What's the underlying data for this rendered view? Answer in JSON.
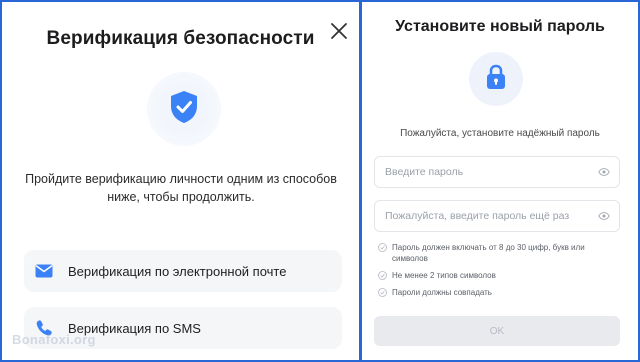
{
  "left": {
    "title": "Верификация безопасности",
    "description": "Пройдите верификацию личности одним из способов ниже, чтобы продолжить.",
    "options": [
      {
        "label": "Верификация по электронной почте",
        "icon": "envelope-icon"
      },
      {
        "label": "Верификация по SMS",
        "icon": "phone-icon"
      }
    ],
    "close_icon": "close-icon",
    "shield_icon": "shield-check-icon",
    "watermark": "Bonafoxi.org"
  },
  "right": {
    "title": "Установите новый пароль",
    "subtitle": "Пожалуйста, установите надёжный пароль",
    "password_placeholder": "Введите пароль",
    "confirm_placeholder": "Пожалуйста, введите пароль ещё раз",
    "rules": [
      "Пароль должен включать от 8 до 30 цифр, букв или символов",
      "Не менее 2 типов символов",
      "Пароли должны совпадать"
    ],
    "ok_label": "OK",
    "lock_icon": "lock-icon"
  },
  "colors": {
    "accent": "#3b82f6",
    "frame": "#2a67d6",
    "option_bg": "#f5f6f8",
    "disabled_button": "#e8eaee"
  }
}
